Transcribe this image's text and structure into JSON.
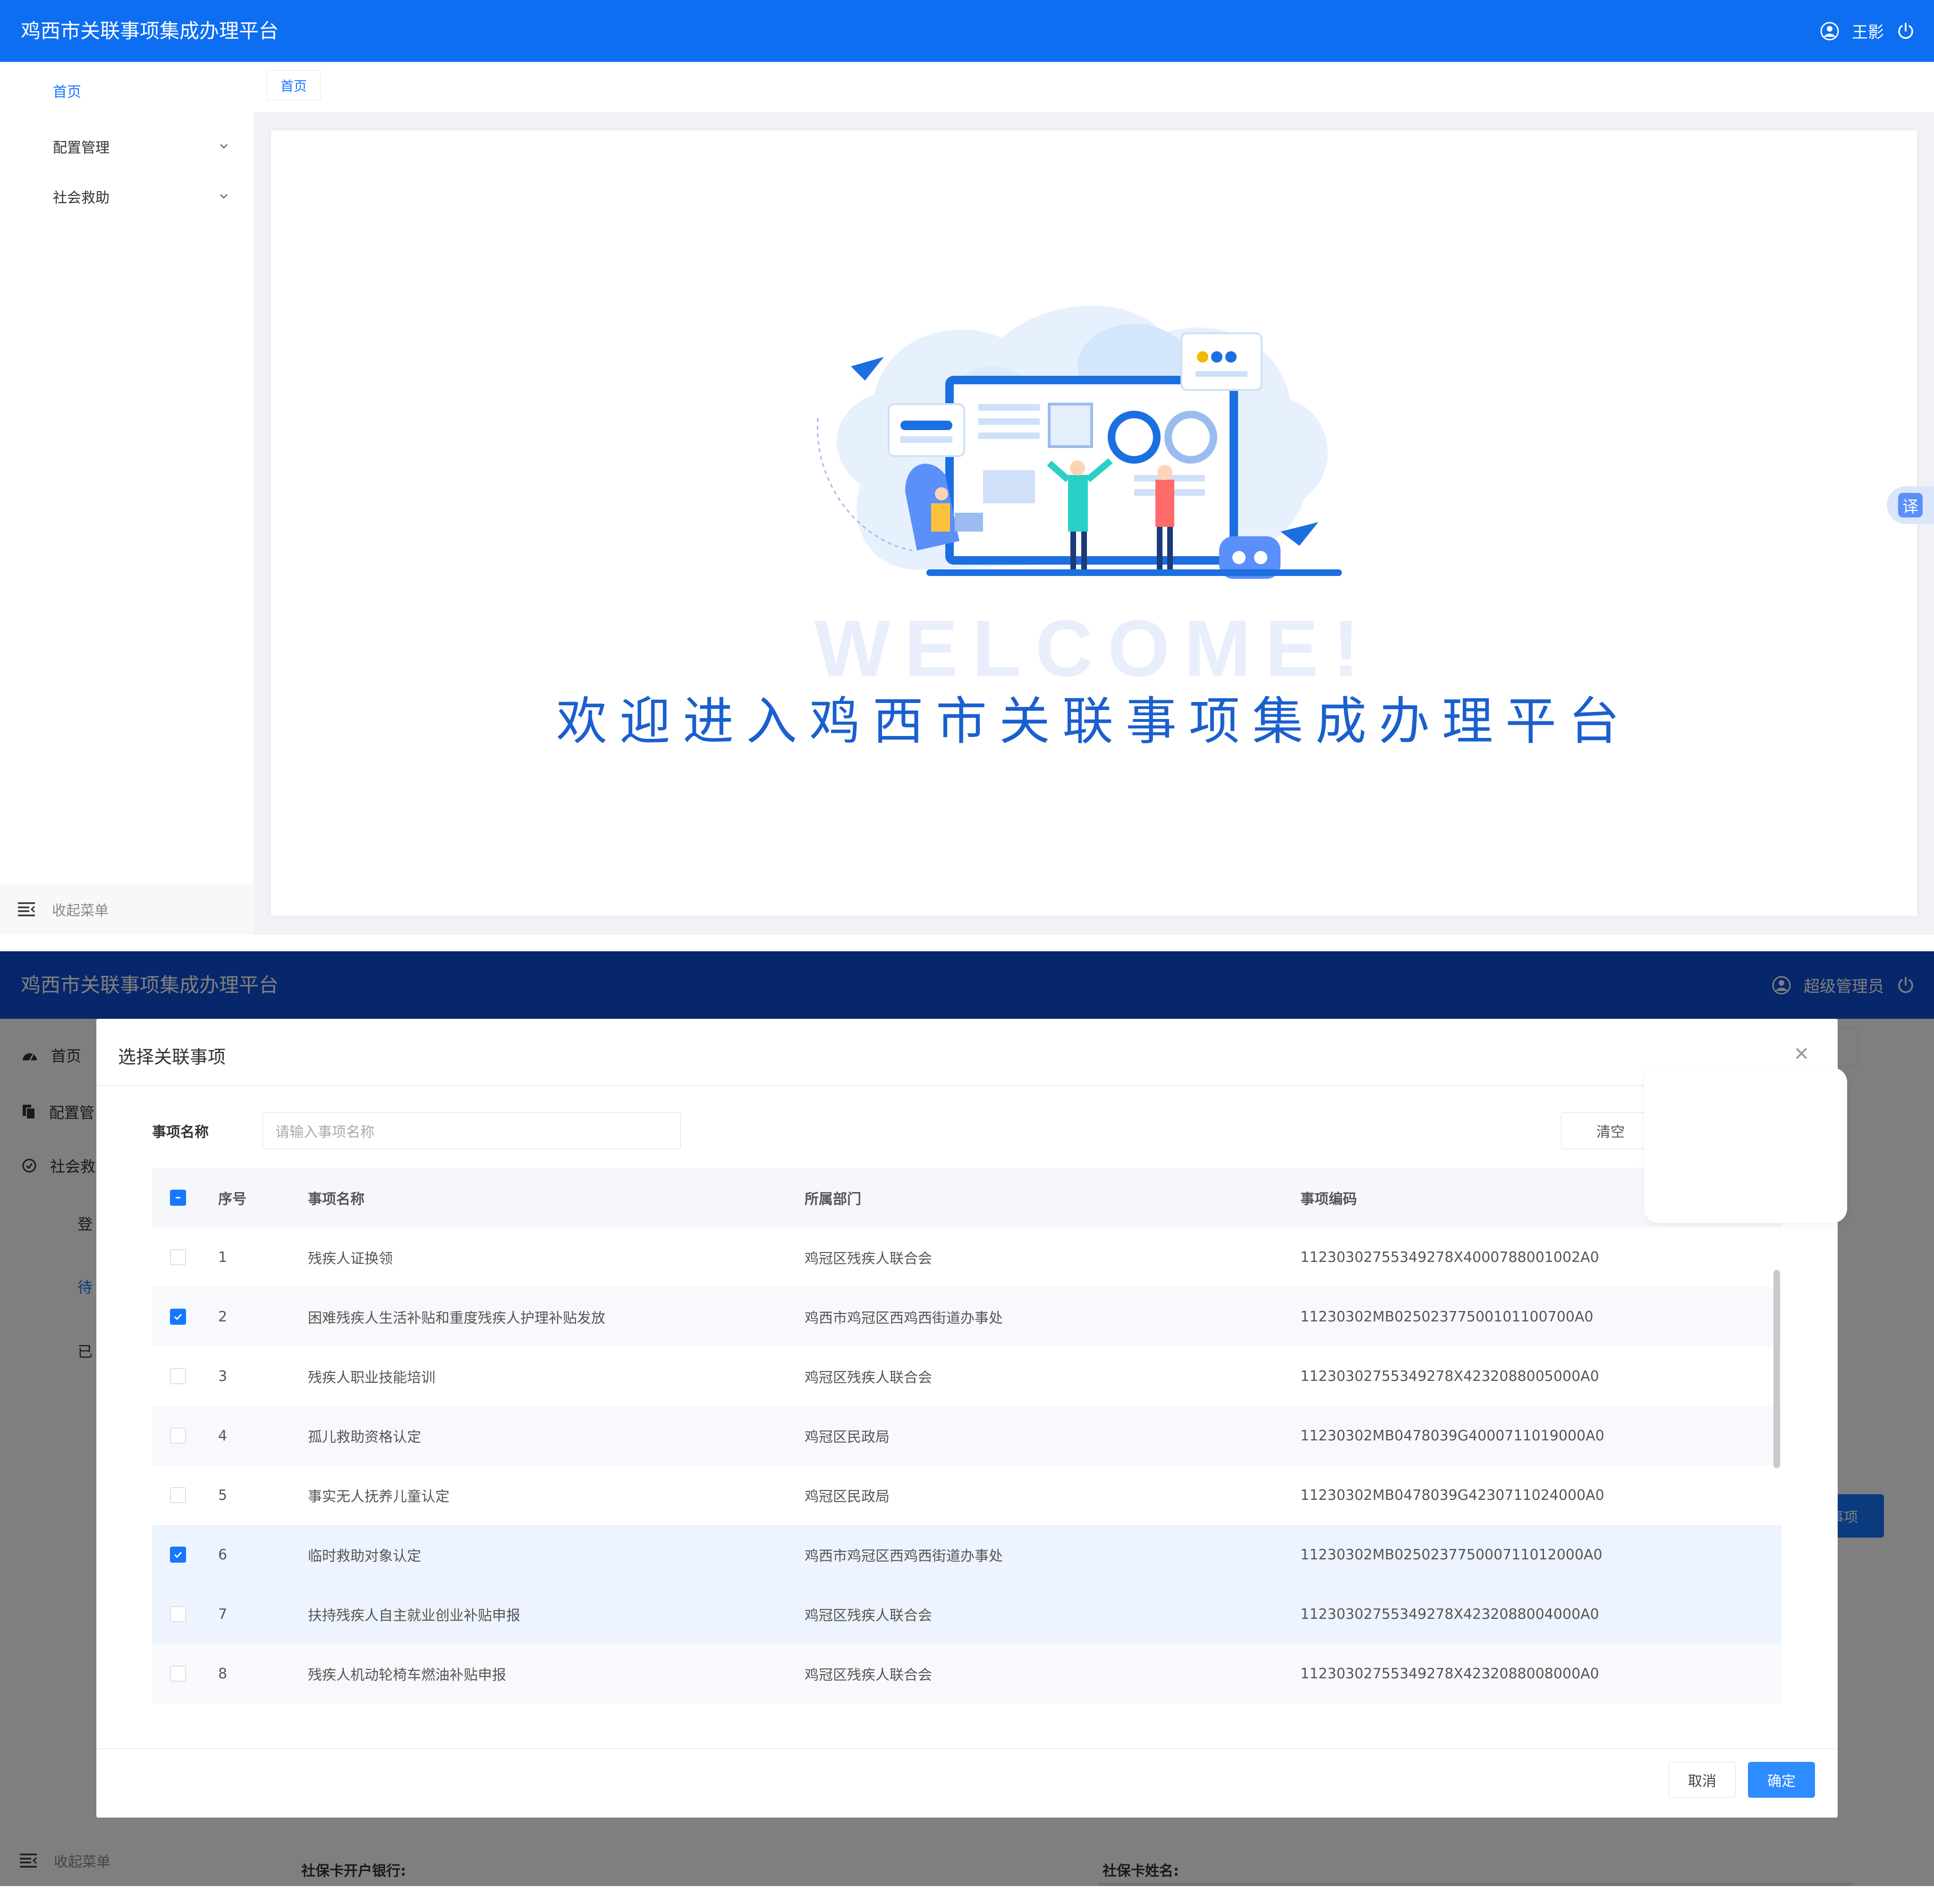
{
  "app_title": "鸡西市关联事项集成办理平台",
  "panel1": {
    "user_name": "王影",
    "sidebar": {
      "items": [
        {
          "label": "首页"
        },
        {
          "label": "配置管理"
        },
        {
          "label": "社会救助"
        }
      ],
      "collapse_label": "收起菜单"
    },
    "tab_label": "首页",
    "welcome_en": "WELCOME!",
    "welcome_zh": "欢迎进入鸡西市关联事项集成办理平台",
    "translate_label": "译"
  },
  "panel2": {
    "user_name": "超级管理员",
    "sidebar": {
      "home_label": "首页",
      "config_label": "配置管",
      "social_label": "社会救",
      "sub1": "登",
      "sub2": "待",
      "sub3": "已",
      "collapse_label": "收起菜单"
    },
    "side_button_label": "事项",
    "form": {
      "bank_label": "社保卡开户银行:",
      "card_name_label": "社保卡姓名:"
    },
    "modal": {
      "title": "选择关联事项",
      "filter_label": "事项名称",
      "filter_placeholder": "请输入事项名称",
      "clear_label": "清空",
      "columns": [
        "序号",
        "事项名称",
        "所属部门",
        "事项编码"
      ],
      "rows": [
        {
          "seq": "1",
          "name": "残疾人证换领",
          "dept": "鸡冠区残疾人联合会",
          "code": "11230302755349278X4000788001002A0",
          "checked": false
        },
        {
          "seq": "2",
          "name": "困难残疾人生活补贴和重度残疾人护理补贴发放",
          "dept": "鸡西市鸡冠区西鸡西街道办事处",
          "code": "11230302MB02502377500101100700A0",
          "checked": true
        },
        {
          "seq": "3",
          "name": "残疾人职业技能培训",
          "dept": "鸡冠区残疾人联合会",
          "code": "11230302755349278X4232088005000A0",
          "checked": false
        },
        {
          "seq": "4",
          "name": "孤儿救助资格认定",
          "dept": "鸡冠区民政局",
          "code": "11230302MB0478039G4000711019000A0",
          "checked": false
        },
        {
          "seq": "5",
          "name": "事实无人抚养儿童认定",
          "dept": "鸡冠区民政局",
          "code": "11230302MB0478039G4230711024000A0",
          "checked": false
        },
        {
          "seq": "6",
          "name": "临时救助对象认定",
          "dept": "鸡西市鸡冠区西鸡西街道办事处",
          "code": "11230302MB025023775000711012000A0",
          "checked": true
        },
        {
          "seq": "7",
          "name": "扶持残疾人自主就业创业补贴申报",
          "dept": "鸡冠区残疾人联合会",
          "code": "11230302755349278X4232088004000A0",
          "checked": false
        },
        {
          "seq": "8",
          "name": "残疾人机动轮椅车燃油补贴申报",
          "dept": "鸡冠区残疾人联合会",
          "code": "11230302755349278X4232088008000A0",
          "checked": false
        }
      ],
      "cancel_label": "取消",
      "ok_label": "确定"
    }
  },
  "colors": {
    "topbar1": "#0d6ef2",
    "topbar2": "#0d4fd6",
    "accent": "#1677ff",
    "welcome_text": "#1a5fcf"
  }
}
